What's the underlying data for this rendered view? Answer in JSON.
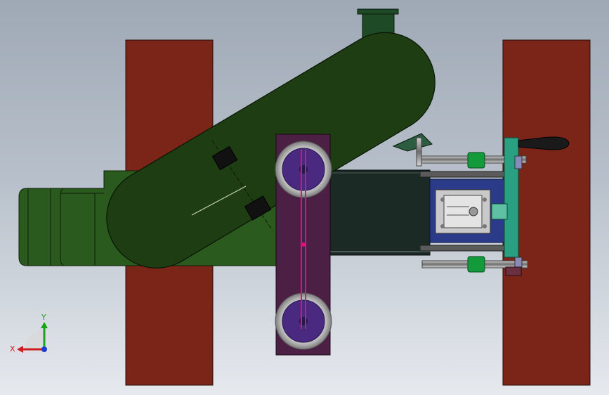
{
  "triad": {
    "x_label": "X",
    "y_label": "Y",
    "x_color": "#d01e1e",
    "y_color": "#19a419",
    "z_color": "#1e3cd0"
  },
  "colors": {
    "background_top": "#9fa9b5",
    "background_bottom": "#e6e9ee",
    "side_plate": "#7b2519",
    "arm_green": "#1f3d12",
    "base_green": "#2a5a1e",
    "motor_plate": "#4c1f45",
    "pulley_face": "#4a2a80",
    "belt": "#e0107a",
    "screw_green": "#139a3a",
    "bracket_teal": "#2aa082"
  }
}
